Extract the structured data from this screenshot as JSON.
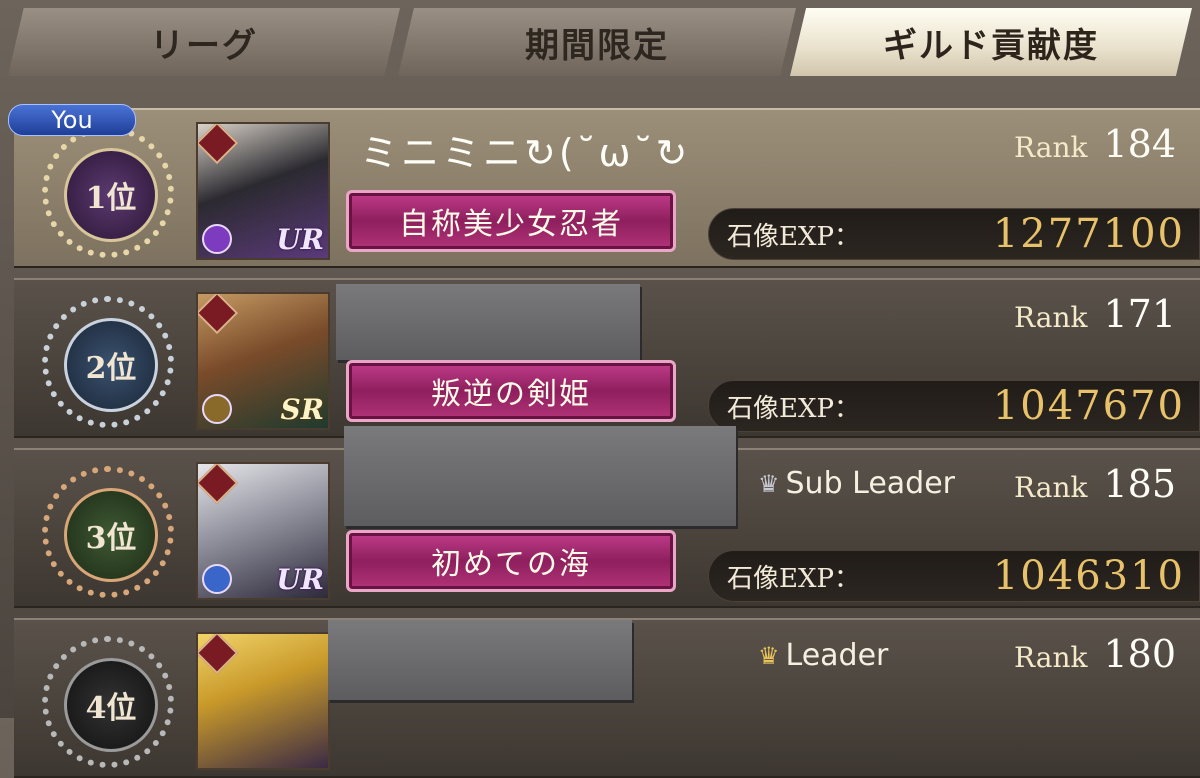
{
  "tabs": [
    {
      "label": "リーグ",
      "active": false
    },
    {
      "label": "期間限定",
      "active": false
    },
    {
      "label": "ギルド貢献度",
      "active": true
    }
  ],
  "you_badge": "You",
  "rank_label": "Rank",
  "exp_label": "石像EXP：",
  "rows": [
    {
      "position": "1位",
      "name": "ミニミニ↻(˘ω˘↻",
      "role": "",
      "rank": "184",
      "title": "自称美少女忍者",
      "exp": "1277100",
      "rarity": "UR",
      "medal_color": "#4a2a5c",
      "element_color": "#7d3bbf"
    },
    {
      "position": "2位",
      "name": "",
      "role": "",
      "rank": "171",
      "title": "叛逆の剣姫",
      "exp": "1047670",
      "rarity": "SR",
      "medal_color": "#2a3b52",
      "element_color": "#8a6a2a"
    },
    {
      "position": "3位",
      "name": "",
      "role": "Sub Leader",
      "rank": "185",
      "title": "初めての海",
      "exp": "1046310",
      "rarity": "UR",
      "medal_color": "#2f4a26",
      "element_color": "#3a66c9"
    },
    {
      "position": "4位",
      "name": "",
      "role": "Leader",
      "rank": "180",
      "title": "",
      "exp": "",
      "rarity": "",
      "medal_color": "#242424",
      "element_color": "#555555"
    }
  ]
}
